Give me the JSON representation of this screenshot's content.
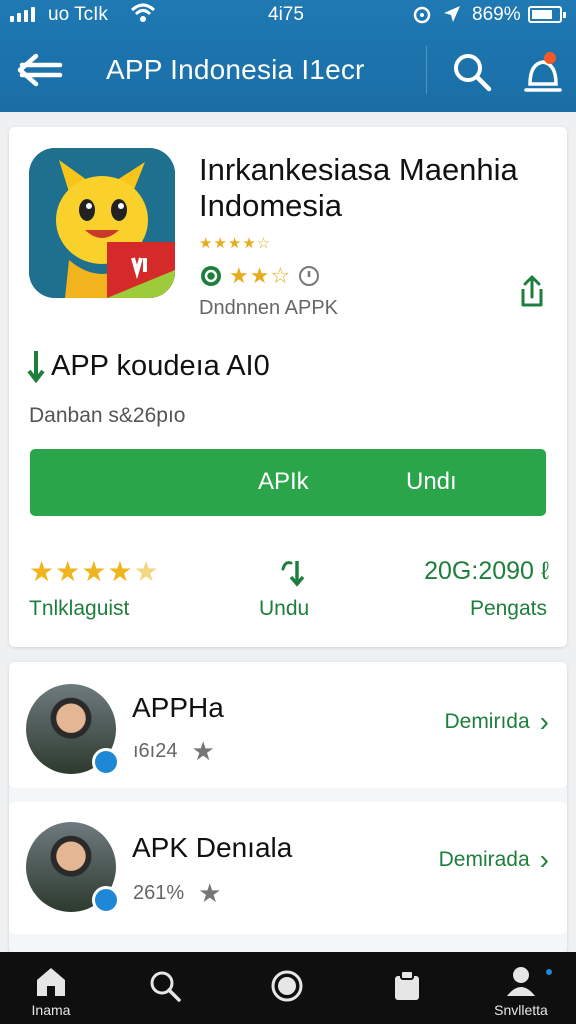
{
  "status_bar": {
    "carrier": "uo TcIk",
    "time": "4i75",
    "battery": "869%"
  },
  "app_bar": {
    "title": "APP Indonesia I1ecr",
    "back_icon": "arrow-left-icon",
    "search_icon": "search-icon",
    "notification_icon": "bell-icon"
  },
  "app": {
    "name_line1": "Inrkankesiasa Maenhia",
    "name_line2": "Indomesia",
    "rating_small": "★★★★☆",
    "rating_row": "★★☆",
    "developer": "Dndnnen APPK",
    "subtitle": "APP koudeıa AI0",
    "size": "Danban s&26pıo",
    "install_label": "APIk",
    "install_label_2": "Undı"
  },
  "stats": {
    "rating_stars": 4.5,
    "rating_label": "Tnlklaguist",
    "download_label": "Undu",
    "count": "20G:2090",
    "count_label": "Pengats"
  },
  "list": [
    {
      "name": "APPHa",
      "count": "ı6ı24",
      "action": "Demirıda"
    },
    {
      "name": "APK Denıala",
      "count": "261%",
      "action": "Demirada"
    }
  ],
  "bottom_nav": [
    {
      "icon": "home-icon",
      "label": "Inama"
    },
    {
      "icon": "search-icon",
      "label": ""
    },
    {
      "icon": "circle-icon",
      "label": ""
    },
    {
      "icon": "apps-icon",
      "label": ""
    },
    {
      "icon": "profile-icon",
      "label": "Snvlletta"
    }
  ],
  "colors": {
    "app_bar": "#1f79b3",
    "accent_green": "#2aa54a",
    "text_green": "#1e7f3c",
    "star_gold": "#f0b41c",
    "badge_blue": "#1e88d6"
  }
}
